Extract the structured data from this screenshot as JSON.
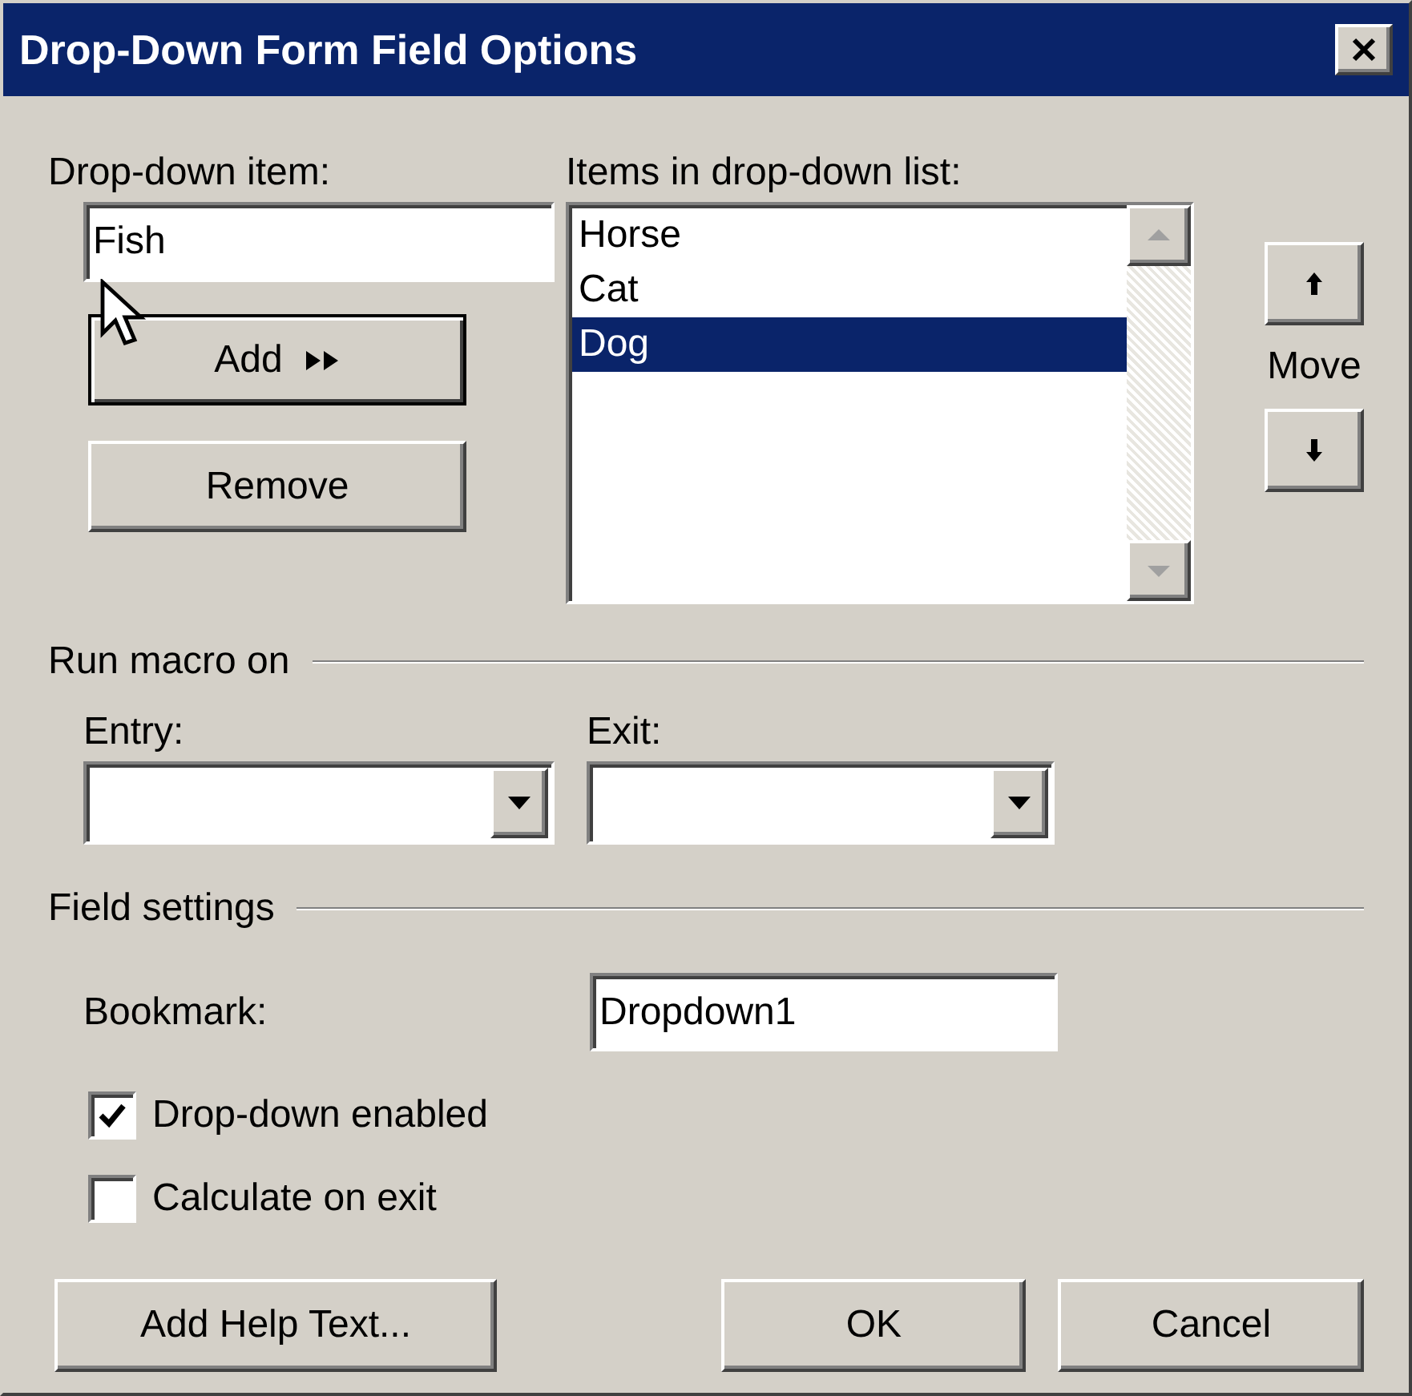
{
  "window": {
    "title": "Drop-Down Form Field Options"
  },
  "drop_down_item": {
    "label": "Drop-down item:",
    "value": "Fish"
  },
  "list_buttons": [
    {
      "label": "Add",
      "kind": "add",
      "default": true
    },
    {
      "label": "Remove",
      "kind": "plain",
      "default": false
    }
  ],
  "items_list": {
    "label": "Items in drop-down list:",
    "items": [
      {
        "text": "Horse",
        "selected": false
      },
      {
        "text": "Cat",
        "selected": false
      },
      {
        "text": "Dog",
        "selected": true
      }
    ]
  },
  "move": {
    "label": "Move"
  },
  "run_macro": {
    "title": "Run macro on",
    "entry": {
      "label": "Entry:"
    },
    "exit": {
      "label": "Exit:"
    }
  },
  "field_settings": {
    "title": "Field settings",
    "bookmark": {
      "label": "Bookmark:",
      "value": "Dropdown1"
    },
    "checkboxes": [
      {
        "label": "Drop-down enabled",
        "checked": true
      },
      {
        "label": "Calculate on exit",
        "checked": false
      }
    ]
  },
  "buttons": [
    {
      "label": "Add Help Text..."
    },
    {
      "label": "OK"
    },
    {
      "label": "Cancel"
    }
  ]
}
